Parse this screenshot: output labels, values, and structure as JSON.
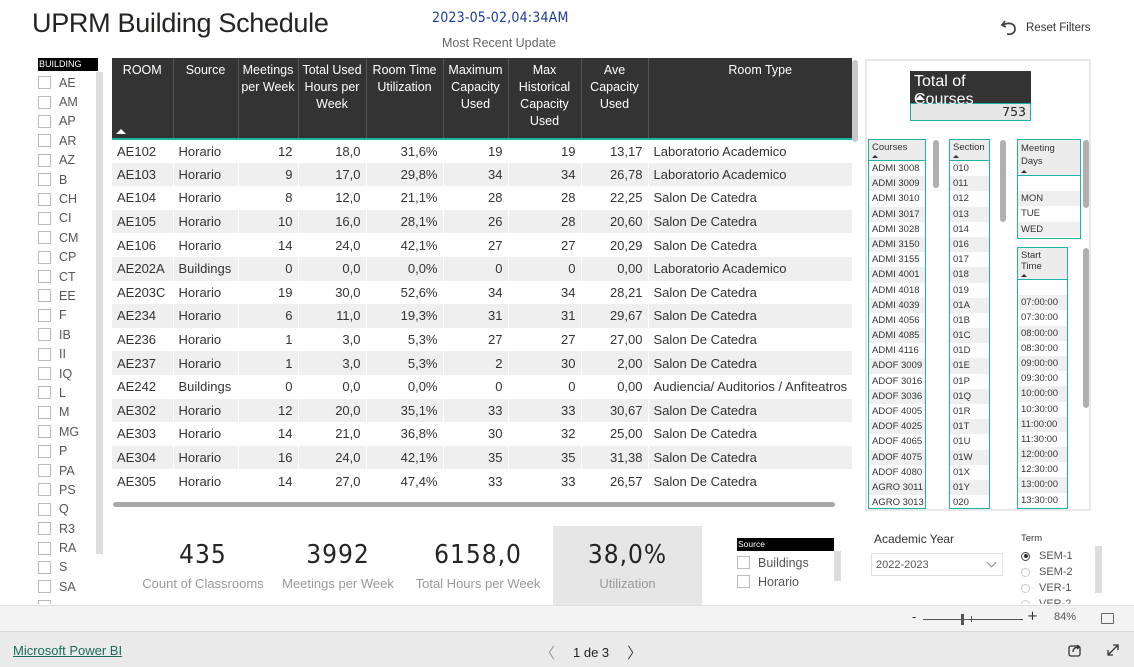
{
  "header": {
    "title": "UPRM Building Schedule",
    "update_time": "2023-05-02,04:34AM",
    "update_label": "Most Recent Update",
    "reset_label": "Reset Filters"
  },
  "building_slicer": {
    "title": "BUILDING",
    "items": [
      "AE",
      "AM",
      "AP",
      "AR",
      "AZ",
      "B",
      "CH",
      "CI",
      "CM",
      "CP",
      "CT",
      "EE",
      "F",
      "IB",
      "II",
      "IQ",
      "L",
      "M",
      "MG",
      "P",
      "PA",
      "PS",
      "Q",
      "R3",
      "RA",
      "S",
      "SA",
      ""
    ]
  },
  "table": {
    "columns": [
      "ROOM",
      "Source",
      "Meetings per Week",
      "Total Used Hours per Week",
      "Room Time Utilization",
      "Maximum Capacity Used",
      "Max Historical Capacity Used",
      "Ave Capacity Used",
      "Room Type"
    ],
    "rows": [
      [
        "AE102",
        "Horario",
        "12",
        "18,0",
        "31,6%",
        "19",
        "19",
        "13,17",
        "Laboratorio Academico"
      ],
      [
        "AE103",
        "Horario",
        "9",
        "17,0",
        "29,8%",
        "34",
        "34",
        "26,78",
        "Laboratorio Academico"
      ],
      [
        "AE104",
        "Horario",
        "8",
        "12,0",
        "21,1%",
        "28",
        "28",
        "22,25",
        "Salon De Catedra"
      ],
      [
        "AE105",
        "Horario",
        "10",
        "16,0",
        "28,1%",
        "26",
        "28",
        "20,60",
        "Salon De Catedra"
      ],
      [
        "AE106",
        "Horario",
        "14",
        "24,0",
        "42,1%",
        "27",
        "27",
        "20,29",
        "Salon De Catedra"
      ],
      [
        "AE202A",
        "Buildings",
        "0",
        "0,0",
        "0,0%",
        "0",
        "0",
        "0,00",
        "Laboratorio Academico"
      ],
      [
        "AE203C",
        "Horario",
        "19",
        "30,0",
        "52,6%",
        "34",
        "34",
        "28,21",
        "Salon De Catedra"
      ],
      [
        "AE234",
        "Horario",
        "6",
        "11,0",
        "19,3%",
        "31",
        "31",
        "29,67",
        "Salon De Catedra"
      ],
      [
        "AE236",
        "Horario",
        "1",
        "3,0",
        "5,3%",
        "27",
        "27",
        "27,00",
        "Salon De Catedra"
      ],
      [
        "AE237",
        "Horario",
        "1",
        "3,0",
        "5,3%",
        "2",
        "30",
        "2,00",
        "Salon De Catedra"
      ],
      [
        "AE242",
        "Buildings",
        "0",
        "0,0",
        "0,0%",
        "0",
        "0",
        "0,00",
        "Audiencia/ Auditorios / Anfiteatros"
      ],
      [
        "AE302",
        "Horario",
        "12",
        "20,0",
        "35,1%",
        "33",
        "33",
        "30,67",
        "Salon De Catedra"
      ],
      [
        "AE303",
        "Horario",
        "14",
        "21,0",
        "36,8%",
        "30",
        "32",
        "25,00",
        "Salon De Catedra"
      ],
      [
        "AE304",
        "Horario",
        "16",
        "24,0",
        "42,1%",
        "35",
        "35",
        "31,38",
        "Salon De Catedra"
      ],
      [
        "AE305",
        "Horario",
        "14",
        "27,0",
        "47,4%",
        "33",
        "33",
        "26,57",
        "Salon De Catedra"
      ]
    ]
  },
  "total_courses": {
    "title": "Total of Courses",
    "value": "753"
  },
  "courses": {
    "title": "Courses",
    "items": [
      "ADMI 3008",
      "ADMI 3009",
      "ADMI 3010",
      "ADMI 3017",
      "ADMI 3028",
      "ADMI 3150",
      "ADMI 3155",
      "ADMI 4001",
      "ADMI 4018",
      "ADMI 4039",
      "ADMI 4056",
      "ADMI 4085",
      "ADMI 4116",
      "ADOF 3009",
      "ADOF 3016",
      "ADOF 3036",
      "ADOF 4005",
      "ADOF 4025",
      "ADOF 4065",
      "ADOF 4075",
      "ADOF 4080",
      "AGRO 3011",
      "AGRO 3013"
    ]
  },
  "sections": {
    "title": "Section",
    "items": [
      "010",
      "011",
      "012",
      "013",
      "014",
      "016",
      "017",
      "018",
      "019",
      "01A",
      "01B",
      "01C",
      "01D",
      "01E",
      "01P",
      "01Q",
      "01R",
      "01T",
      "01U",
      "01W",
      "01X",
      "01Y",
      "020"
    ]
  },
  "meeting_days": {
    "title": "Meeting Days",
    "items": [
      "",
      "MON",
      "TUE",
      "WED"
    ]
  },
  "start_time": {
    "title": "Start Time",
    "items": [
      "",
      "07:00:00",
      "07:30:00",
      "08:00:00",
      "08:30:00",
      "09:00:00",
      "09:30:00",
      "10:00:00",
      "10:30:00",
      "11:00:00",
      "11:30:00",
      "12:00:00",
      "12:30:00",
      "13:00:00",
      "13:30:00",
      "14:00:00"
    ]
  },
  "kpis": [
    {
      "value": "435",
      "label": "Count of Classrooms"
    },
    {
      "value": "3992",
      "label": "Meetings per Week"
    },
    {
      "value": "6158,0",
      "label": "Total Hours per Week"
    },
    {
      "value": "38,0%",
      "label": "Utilization"
    }
  ],
  "source_slicer": {
    "title": "Source",
    "items": [
      "Buildings",
      "Horario"
    ]
  },
  "academic_year": {
    "label": "Academic Year",
    "selected": "2022-2023"
  },
  "term": {
    "label": "Term",
    "items": [
      {
        "label": "SEM-1",
        "selected": true
      },
      {
        "label": "SEM-2",
        "selected": false
      },
      {
        "label": "VER-1",
        "selected": false
      },
      {
        "label": "VER-2",
        "selected": false
      }
    ]
  },
  "zoom": {
    "minus": "-",
    "plus": "+",
    "level": "84%"
  },
  "footer": {
    "brand": "Microsoft Power BI",
    "page_indicator": "1 de 3",
    "prev": "〈",
    "next": "〉"
  },
  "colors": {
    "accent": "#1fb3a6",
    "header_bg": "#333333",
    "update_time": "#1a3a9c",
    "brand_link": "#1b6c5b"
  }
}
